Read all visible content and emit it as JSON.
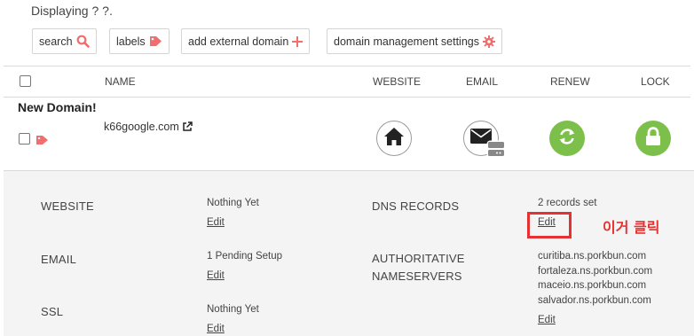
{
  "header": {
    "displaying": "Displaying ? ?."
  },
  "toolbar": {
    "search_label": "search",
    "labels_label": "labels",
    "add_domain_label": "add external domain",
    "settings_label": "domain management settings"
  },
  "table": {
    "columns": {
      "name": "NAME",
      "website": "WEBSITE",
      "email": "EMAIL",
      "renew": "RENEW",
      "lock": "LOCK"
    }
  },
  "row": {
    "title": "New Domain!",
    "domain": "k66google.com",
    "icons": [
      "home-icon",
      "email-icon",
      "renew-icon",
      "lock-icon"
    ]
  },
  "details": {
    "website": {
      "label": "WEBSITE",
      "value": "Nothing Yet",
      "edit": "Edit"
    },
    "email": {
      "label": "EMAIL",
      "value": "1 Pending Setup",
      "edit": "Edit"
    },
    "ssl": {
      "label": "SSL",
      "value": "Nothing Yet",
      "edit": "Edit"
    },
    "dns": {
      "label": "DNS RECORDS",
      "value": "2 records set",
      "edit": "Edit"
    },
    "nameservers": {
      "label_line1": "AUTHORITATIVE",
      "label_line2": "NAMESERVERS",
      "servers": [
        "curitiba.ns.porkbun.com",
        "fortaleza.ns.porkbun.com",
        "maceio.ns.porkbun.com",
        "salvador.ns.porkbun.com"
      ],
      "edit": "Edit"
    }
  },
  "annotation": {
    "text": "이거 클릭",
    "color": "#e53131"
  },
  "colors": {
    "accent": "#f26d6d",
    "green": "#7cc04b",
    "dark_icon": "#222222"
  }
}
